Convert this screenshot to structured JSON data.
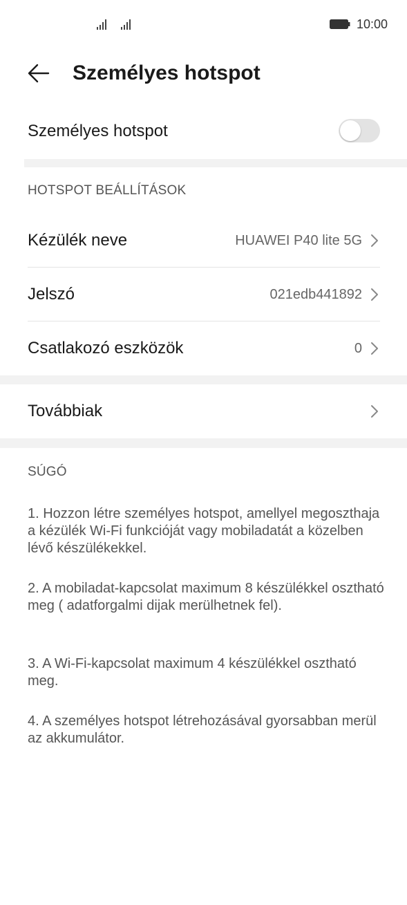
{
  "status_bar": {
    "time": "10:00",
    "icons": [
      "signal-icon",
      "signal-icon",
      "battery-icon"
    ]
  },
  "header": {
    "title": "Személyes hotspot",
    "back_icon": "back-arrow-icon"
  },
  "hotspot_toggle": {
    "label": "Személyes hotspot",
    "enabled": false
  },
  "settings": {
    "section_title": "HOTSPOT BEÁLLÍTÁSOK",
    "device_name": {
      "label": "Kézülék neve",
      "value": "HUAWEI P40 lite 5G"
    },
    "password": {
      "label": "Jelszó",
      "value": "021edb441892"
    },
    "connected_devices": {
      "label": "Csatlakozó eszközök",
      "value": "0"
    }
  },
  "more": {
    "label": "Továbbiak"
  },
  "help": {
    "title": "SÚGÓ",
    "items": [
      "1. Hozzon létre személyes hotspot, amellyel megoszthaja a kézülék Wi-Fi funkcióját vagy mobiladatát a közelben lévő készülékekkel.",
      "2. A mobiladat-kapcsolat maximum 8 készülékkel osztható meg ( adatforgalmi dijak merülhetnek fel).",
      "3. A Wi-Fi-kapcsolat maximum 4 készülékkel osztható meg.",
      "4. A személyes hotspot létrehozásával gyorsabban merül az akkumulátor."
    ]
  },
  "colors": {
    "background": "#ffffff",
    "section_band": "#f2f2f2",
    "toggle_off": "#e3e3e3",
    "text_primary": "#1a1a1a",
    "text_secondary": "#555555"
  }
}
